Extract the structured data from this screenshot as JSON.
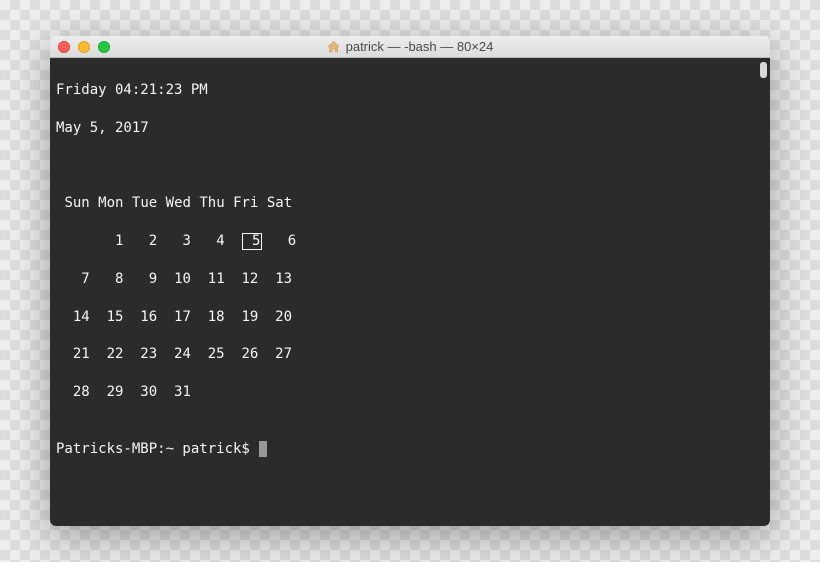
{
  "window": {
    "title": "patrick — -bash — 80×24"
  },
  "terminal": {
    "line1": "Friday 04:21:23 PM",
    "line2": "May 5, 2017",
    "calendar": {
      "headers": [
        "Sun",
        "Mon",
        "Tue",
        "Wed",
        "Thu",
        "Fri",
        "Sat"
      ],
      "rows": [
        [
          "",
          "1",
          "2",
          "3",
          "4",
          "5",
          "6"
        ],
        [
          "7",
          "8",
          "9",
          "10",
          "11",
          "12",
          "13"
        ],
        [
          "14",
          "15",
          "16",
          "17",
          "18",
          "19",
          "20"
        ],
        [
          "21",
          "22",
          "23",
          "24",
          "25",
          "26",
          "27"
        ],
        [
          "28",
          "29",
          "30",
          "31",
          "",
          "",
          ""
        ]
      ],
      "highlighted_day": "5"
    },
    "prompt": "Patricks-MBP:~ patrick$"
  }
}
